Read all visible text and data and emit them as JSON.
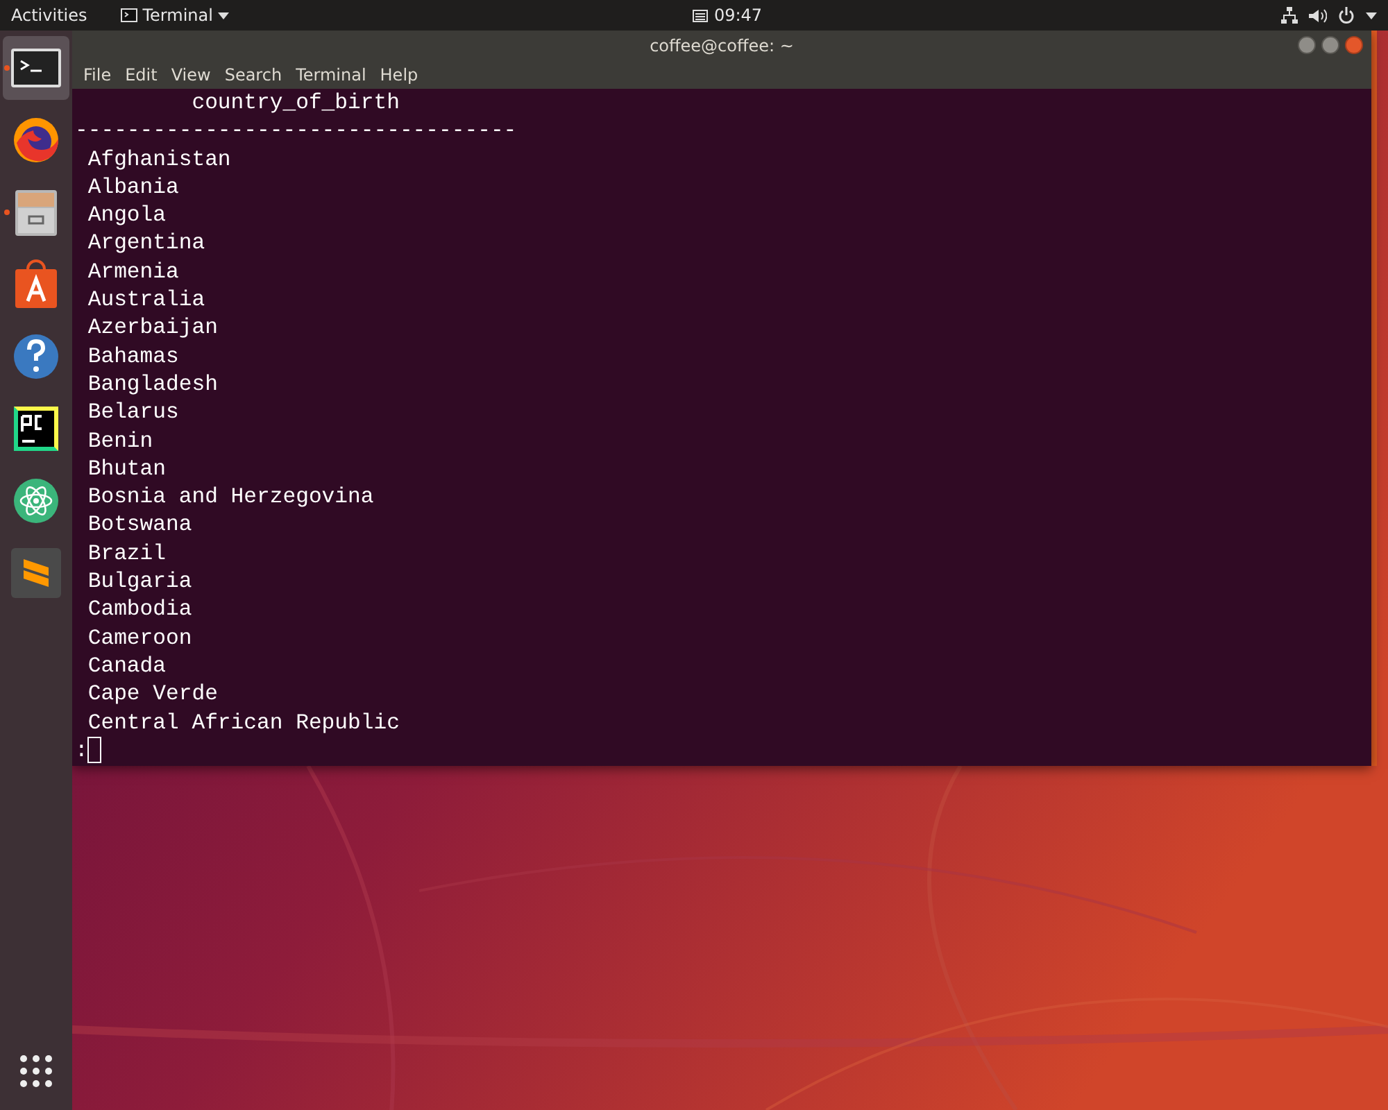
{
  "top_bar": {
    "activities": "Activities",
    "app_menu": "Terminal",
    "clock": "09:47"
  },
  "dock": {
    "items": [
      {
        "kind": "terminal",
        "running": true,
        "selected": true
      },
      {
        "kind": "firefox",
        "running": false,
        "selected": false
      },
      {
        "kind": "files",
        "running": true,
        "selected": false
      },
      {
        "kind": "software",
        "running": false,
        "selected": false
      },
      {
        "kind": "help",
        "running": false,
        "selected": false
      },
      {
        "kind": "pycharm",
        "running": false,
        "selected": false
      },
      {
        "kind": "atom",
        "running": false,
        "selected": false
      },
      {
        "kind": "sublime",
        "running": false,
        "selected": false
      }
    ]
  },
  "window": {
    "title": "coffee@coffee: ~",
    "menu": [
      "File",
      "Edit",
      "View",
      "Search",
      "Terminal",
      "Help"
    ],
    "terminal": {
      "lines": [
        "         country_of_birth",
        "----------------------------------",
        " Afghanistan",
        " Albania",
        " Angola",
        " Argentina",
        " Armenia",
        " Australia",
        " Azerbaijan",
        " Bahamas",
        " Bangladesh",
        " Belarus",
        " Benin",
        " Bhutan",
        " Bosnia and Herzegovina",
        " Botswana",
        " Brazil",
        " Bulgaria",
        " Cambodia",
        " Cameroon",
        " Canada",
        " Cape Verde",
        " Central African Republic"
      ],
      "prompt": ":"
    }
  }
}
